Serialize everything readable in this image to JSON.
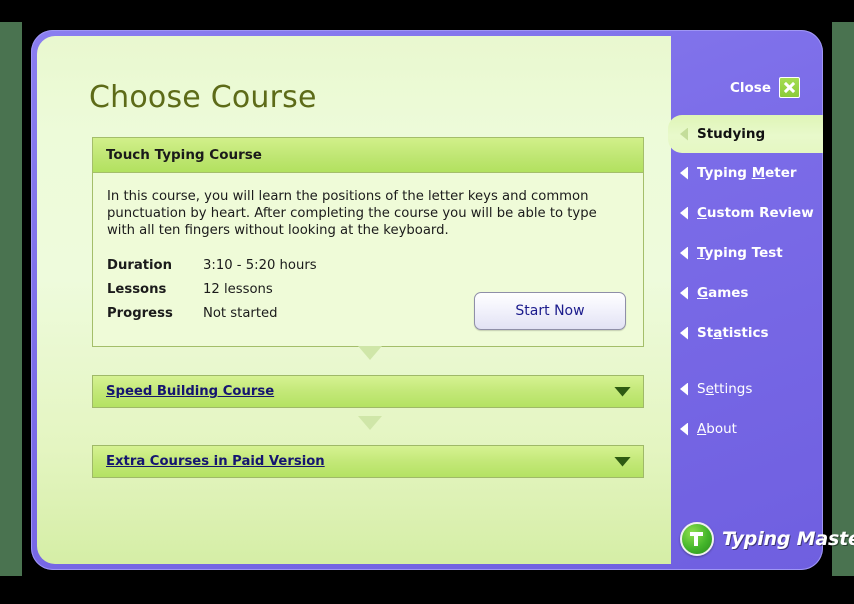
{
  "window": {
    "title": "Choose Course",
    "close_label": "Close",
    "close_icon": "close-x-icon"
  },
  "main": {
    "expanded_course": {
      "header": "Touch Typing Course",
      "description": "In this course, you will learn the positions of the letter keys and common punctuation by heart. After completing the course you will be able to type with all ten fingers without looking at the keyboard.",
      "meta": [
        {
          "label": "Duration",
          "value": "3:10 - 5:20 hours"
        },
        {
          "label": "Lessons",
          "value": "12 lessons"
        },
        {
          "label": "Progress",
          "value": "Not started"
        }
      ],
      "action_label": "Start Now"
    },
    "collapsed_courses": [
      {
        "title": "Speed Building Course",
        "chevron": "chevron-down-icon"
      },
      {
        "title": "Extra Courses in Paid Version",
        "chevron": "chevron-down-icon"
      }
    ]
  },
  "sidebar": {
    "items": [
      {
        "label": "Studying",
        "pre": "",
        "key": "",
        "post": "Studying",
        "active": true,
        "bold": true
      },
      {
        "label": "Typing Meter",
        "pre": "Typing ",
        "key": "M",
        "post": "eter",
        "active": false,
        "bold": true
      },
      {
        "label": "Custom Review",
        "pre": "",
        "key": "C",
        "post": "ustom Review",
        "active": false,
        "bold": true
      },
      {
        "label": "Typing Test",
        "pre": "",
        "key": "T",
        "post": "yping Test",
        "active": false,
        "bold": true
      },
      {
        "label": "Games",
        "pre": "",
        "key": "G",
        "post": "ames",
        "active": false,
        "bold": true
      },
      {
        "label": "Statistics",
        "pre": "St",
        "key": "a",
        "post": "tistics",
        "active": false,
        "bold": true
      }
    ],
    "secondary_items": [
      {
        "label": "Settings",
        "pre": "S",
        "key": "e",
        "post": "ttings",
        "bold": false
      },
      {
        "label": "About",
        "pre": "",
        "key": "A",
        "post": "bout",
        "bold": false
      }
    ],
    "brand": "Typing Master"
  },
  "colors": {
    "frame_outer": "#4a7350",
    "frame_black": "#000000",
    "window_purple": "#7b6ce8",
    "panel_green": "#eefbdc",
    "bar_green": "#c3e878",
    "title_olive": "#5d6b18",
    "link_navy": "#151570",
    "button_text": "#1b1b8c",
    "close_green": "#8ccb39"
  }
}
